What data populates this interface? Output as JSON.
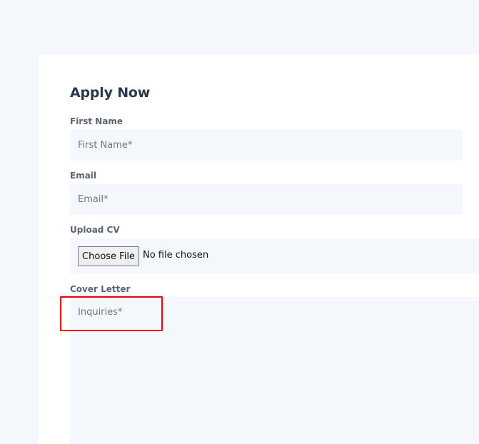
{
  "form": {
    "title": "Apply Now",
    "first_name": {
      "label": "First Name",
      "placeholder": "First Name*",
      "value": ""
    },
    "email": {
      "label": "Email",
      "placeholder": "Email*",
      "value": ""
    },
    "cv": {
      "label": "Upload CV",
      "button_label": "Choose File",
      "status": "No file chosen"
    },
    "cover_letter": {
      "label": "Cover Letter",
      "placeholder": "Inquiries*",
      "value": ""
    }
  },
  "colors": {
    "page_background": "#f4f8fd",
    "card_background": "#ffffff",
    "field_background": "#f4f8fd",
    "title_text": "#2b3a4a",
    "label_text": "#5a6472",
    "placeholder_text": "#6f7782",
    "highlight_border": "#e8000b"
  }
}
